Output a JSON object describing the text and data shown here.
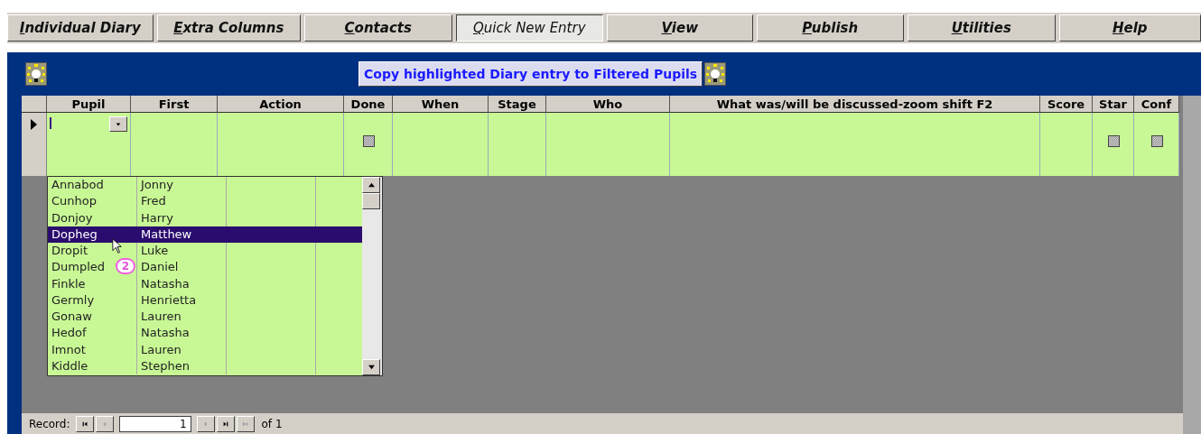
{
  "menu": [
    {
      "label": "Individual Diary",
      "selected": false
    },
    {
      "label": "Extra Columns",
      "selected": false
    },
    {
      "label": "Contacts",
      "selected": false
    },
    {
      "label": "Quick New Entry",
      "selected": true
    },
    {
      "label": "View",
      "selected": false
    },
    {
      "label": "Publish",
      "selected": false
    },
    {
      "label": "Utilities",
      "selected": false
    },
    {
      "label": "Help",
      "selected": false
    }
  ],
  "copy_button": "Copy highlighted Diary entry to Filtered Pupils",
  "columns": [
    {
      "label": "Pupil",
      "kind": "combo"
    },
    {
      "label": "First",
      "kind": "text"
    },
    {
      "label": "Action",
      "kind": "text"
    },
    {
      "label": "Done",
      "kind": "checkbox",
      "checked": false
    },
    {
      "label": "When",
      "kind": "text"
    },
    {
      "label": "Stage",
      "kind": "text"
    },
    {
      "label": "Who",
      "kind": "text"
    },
    {
      "label": "What was/will be discussed-zoom shift F2",
      "kind": "text"
    },
    {
      "label": "Score",
      "kind": "text"
    },
    {
      "label": "Star",
      "kind": "checkbox",
      "checked": false
    },
    {
      "label": "Conf",
      "kind": "checkbox",
      "checked": false
    }
  ],
  "dropdown": [
    {
      "pupil": "Annabod",
      "first": "Jonny",
      "selected": false
    },
    {
      "pupil": "Cunhop",
      "first": "Fred",
      "selected": false
    },
    {
      "pupil": "Donjoy",
      "first": "Harry",
      "selected": false
    },
    {
      "pupil": "Dopheg",
      "first": "Matthew",
      "selected": true
    },
    {
      "pupil": "Dropit",
      "first": "Luke",
      "selected": false
    },
    {
      "pupil": "Dumpled",
      "first": "Daniel",
      "selected": false
    },
    {
      "pupil": "Finkle",
      "first": "Natasha",
      "selected": false
    },
    {
      "pupil": "Germly",
      "first": "Henrietta",
      "selected": false
    },
    {
      "pupil": "Gonaw",
      "first": "Lauren",
      "selected": false
    },
    {
      "pupil": "Hedof",
      "first": "Natasha",
      "selected": false
    },
    {
      "pupil": "Imnot",
      "first": "Lauren",
      "selected": false
    },
    {
      "pupil": "Kiddle",
      "first": "Stephen",
      "selected": false
    }
  ],
  "callout": "2",
  "record_nav": {
    "label": "Record:",
    "value": "1",
    "total": "of 1"
  }
}
